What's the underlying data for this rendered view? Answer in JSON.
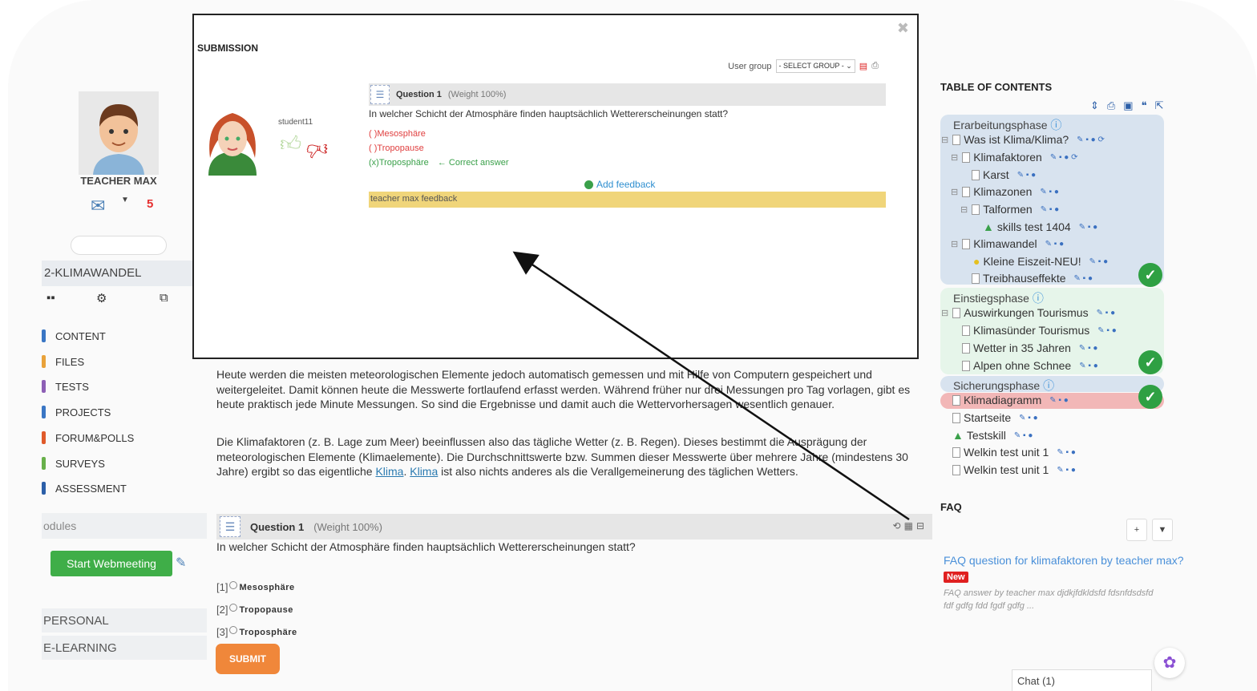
{
  "sidebar": {
    "teacher_name": "TEACHER MAX",
    "message_count": "5",
    "course_name": "2-KLIMAWANDEL",
    "menu": [
      {
        "label": "CONTENT",
        "color": "#3a76c4"
      },
      {
        "label": "FILES",
        "color": "#e9a23a"
      },
      {
        "label": "TESTS",
        "color": "#8d5fb5"
      },
      {
        "label": "PROJECTS",
        "color": "#3a76c4"
      },
      {
        "label": "FORUM&POLLS",
        "color": "#e05a2a"
      },
      {
        "label": "SURVEYS",
        "color": "#68b04a"
      },
      {
        "label": "ASSESSMENT",
        "color": "#2c5fa8"
      }
    ],
    "modules_label": "odules",
    "webmeeting_label": "Start Webmeeting",
    "personal_label": "PERSONAL",
    "elearning_label": "E-LEARNING"
  },
  "main": {
    "paragraph_1": "Heute werden die meisten meteorologischen Elemente jedoch automatisch gemessen und mit Hilfe von Computern gespeichert und weitergeleitet. Damit können heute die Messwerte fortlaufend erfasst werden. Während früher nur drei Messungen pro Tag vorlagen, gibt es heute praktisch jede Minute Messungen. So sind die Ergebnisse und damit auch die Wettervorhersagen wesentlich genauer.",
    "paragraph_2_start": "Die Klimafaktoren (z. B. Lage zum Meer) beeinflussen also das tägliche Wetter (z. B. Regen). Dieses bestimmt die Ausprägung der meteorologischen Elemente (Klimaelemente). Die Durchschnittswerte bzw. Summen dieser Messwerte über mehrere Jahre (mindestens 30 Jahre) ergibt so das eigentliche ",
    "link_1": "Klima",
    "link_2": "Klima",
    "paragraph_2_end": " ist also nichts anderes als die Verallgemeinerung des täglichen Wetters.",
    "question": {
      "title": "Question 1",
      "weight": "(Weight 100%)",
      "text": "In welcher Schicht der Atmosphäre finden hauptsächlich Wettererscheinungen statt?",
      "options": [
        {
          "num": "[1]",
          "label": "Mesosphäre"
        },
        {
          "num": "[2]",
          "label": "Tropopause"
        },
        {
          "num": "[3]",
          "label": "Troposphäre"
        }
      ],
      "submit_label": "SUBMIT"
    }
  },
  "modal": {
    "title": "SUBMISSION",
    "user_group_label": "User group",
    "user_group_value": "- SELECT GROUP -",
    "student_name": "student11",
    "question_title": "Question 1",
    "question_weight": "(Weight 100%)",
    "question_text": "In welcher Schicht der Atmosphäre finden hauptsächlich Wettererscheinungen statt?",
    "answers": [
      {
        "mark": "(  )",
        "label": "Mesosphäre",
        "color": "#e04040"
      },
      {
        "mark": "(  )",
        "label": "Tropopause",
        "color": "#e04040"
      },
      {
        "mark": "(x)",
        "label": "Troposphäre",
        "color": "#3aa04a"
      }
    ],
    "correct_label": "← Correct answer",
    "add_feedback": "Add feedback",
    "feedback_text": "teacher max feedback"
  },
  "toc": {
    "title": "TABLE OF CONTENTS",
    "sections": [
      "Erarbeitungsphase",
      "Einstiegsphase",
      "Sicherungsphase"
    ],
    "items": [
      "Was ist Klima/Klima?",
      "Klimafaktoren",
      "Karst",
      "Klimazonen",
      "Talformen",
      "skills test 1404",
      "Klimawandel",
      "Kleine Eiszeit-NEU!",
      "Treibhauseffekte",
      "Auswirkungen Tourismus",
      "Klimasünder Tourismus",
      "Wetter in 35 Jahren",
      "Alpen ohne Schnee",
      "Klimadiagramm",
      "Startseite",
      "Testskill",
      "Welkin test unit 1",
      "Welkin test unit 1"
    ],
    "colors": {
      "section_blue": "#d8e3ef",
      "section_green": "#e6f5ea",
      "active_red": "#f2b7b7"
    }
  },
  "faq": {
    "title": "FAQ",
    "question": "FAQ question for klimafaktoren by teacher max?",
    "badge": "New",
    "answer": "FAQ answer by teacher max djdkjfdkldsfd fdsnfdsdsfd fdf gdfg fdd fgdf gdfg ..."
  },
  "chat": {
    "label": "Chat (1)"
  }
}
